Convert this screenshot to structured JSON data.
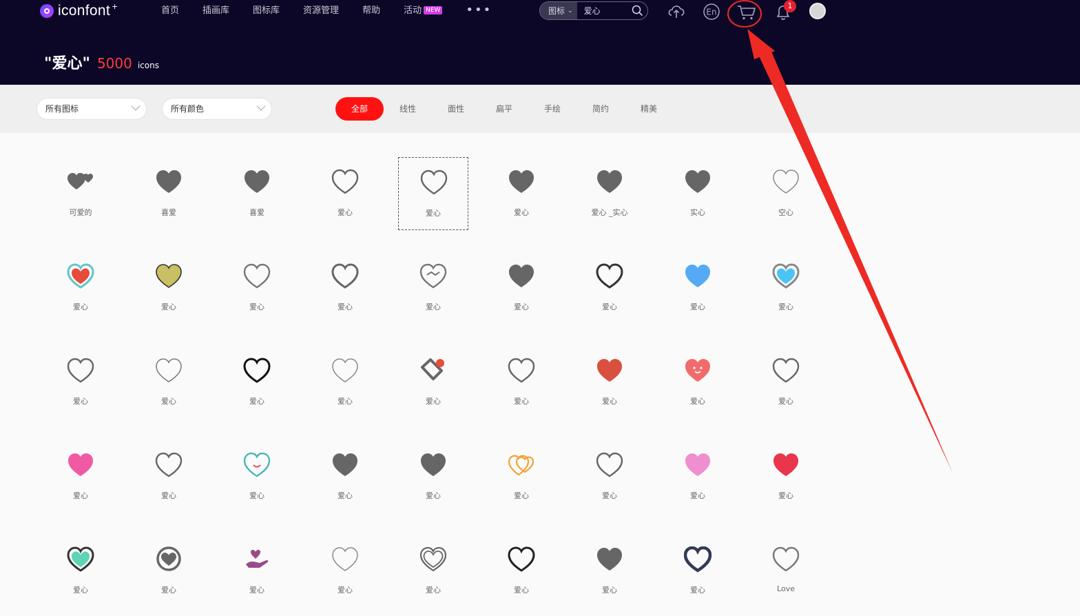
{
  "header": {
    "logo_text": "iconfont",
    "logo_plus": "+",
    "nav": [
      {
        "label": "首页"
      },
      {
        "label": "插画库"
      },
      {
        "label": "图标库"
      },
      {
        "label": "资源管理"
      },
      {
        "label": "帮助"
      },
      {
        "label": "活动",
        "badge": "NEW"
      }
    ],
    "more": "•••",
    "search": {
      "type": "图标",
      "value": "爱心"
    },
    "notification_count": "1",
    "icons": [
      "upload-icon",
      "language-en-icon",
      "cart-icon",
      "bell-icon"
    ]
  },
  "result": {
    "query": "\"爱心\"",
    "count": "5000",
    "unit": "icons"
  },
  "filters": {
    "category": "所有图标",
    "color": "所有颜色",
    "tabs": [
      "全部",
      "线性",
      "面性",
      "扁平",
      "手绘",
      "简约",
      "精美"
    ],
    "active_tab": "全部"
  },
  "icons": [
    {
      "label": "可爱的",
      "style": "double",
      "color": "#666666"
    },
    {
      "label": "喜爱",
      "style": "solid",
      "color": "#666666"
    },
    {
      "label": "喜爱",
      "style": "solid",
      "color": "#666666"
    },
    {
      "label": "爱心",
      "style": "outline",
      "color": "#666666"
    },
    {
      "label": "爱心",
      "style": "outline",
      "color": "#666666"
    },
    {
      "label": "爱心",
      "style": "solid",
      "color": "#666666"
    },
    {
      "label": "爱心 _实心",
      "style": "solid",
      "color": "#666666"
    },
    {
      "label": "实心",
      "style": "solid",
      "color": "#666666"
    },
    {
      "label": "空心",
      "style": "outline-thin",
      "color": "#888888"
    },
    {
      "label": "爱心",
      "style": "two-tone",
      "color": "#e84b3a",
      "accent": "#5fc6c9"
    },
    {
      "label": "爱心",
      "style": "solid-outline",
      "color": "#c9c063"
    },
    {
      "label": "爱心",
      "style": "outline",
      "color": "#777777"
    },
    {
      "label": "爱心",
      "style": "outline-bold",
      "color": "#666666"
    },
    {
      "label": "爱心",
      "style": "handshake",
      "color": "#777777"
    },
    {
      "label": "爱心",
      "style": "solid",
      "color": "#666666"
    },
    {
      "label": "爱心",
      "style": "outline-bold",
      "color": "#333333"
    },
    {
      "label": "爱心",
      "style": "solid",
      "color": "#55aaf5"
    },
    {
      "label": "爱心",
      "style": "two-tone",
      "color": "#4cc3f5",
      "accent": "#888888"
    },
    {
      "label": "爱心",
      "style": "outline",
      "color": "#666666"
    },
    {
      "label": "爱心",
      "style": "outline-thin",
      "color": "#777777"
    },
    {
      "label": "爱心",
      "style": "outline-bold",
      "color": "#111111"
    },
    {
      "label": "爱心",
      "style": "outline-thin",
      "color": "#888888"
    },
    {
      "label": "爱心",
      "style": "tag",
      "color": "#666666",
      "accent": "#e84b3a"
    },
    {
      "label": "爱心",
      "style": "outline",
      "color": "#666666"
    },
    {
      "label": "爱心",
      "style": "solid",
      "color": "#d9503f"
    },
    {
      "label": "爱心",
      "style": "cartoon",
      "color": "#f26b6b"
    },
    {
      "label": "爱心",
      "style": "outline",
      "color": "#666666"
    },
    {
      "label": "爱心",
      "style": "solid",
      "color": "#f05aa3"
    },
    {
      "label": "爱心",
      "style": "outline",
      "color": "#666666"
    },
    {
      "label": "爱心",
      "style": "smile",
      "color": "#3fb3b0",
      "accent": "#e84b6a"
    },
    {
      "label": "爱心",
      "style": "solid",
      "color": "#666666"
    },
    {
      "label": "爱心",
      "style": "solid",
      "color": "#666666"
    },
    {
      "label": "爱心",
      "style": "double-outline",
      "color": "#f2a233"
    },
    {
      "label": "爱心",
      "style": "outline",
      "color": "#666666"
    },
    {
      "label": "爱心",
      "style": "solid",
      "color": "#ef8fcf"
    },
    {
      "label": "爱心",
      "style": "solid",
      "color": "#e8364c"
    },
    {
      "label": "爱心",
      "style": "two-tone",
      "color": "#5fd4b4",
      "accent": "#333333"
    },
    {
      "label": "爱心",
      "style": "ring",
      "color": "#666666"
    },
    {
      "label": "爱心",
      "style": "hand",
      "color": "#9a4a8a"
    },
    {
      "label": "爱心",
      "style": "outline-thin",
      "color": "#888888"
    },
    {
      "label": "爱心",
      "style": "double-line",
      "color": "#666666"
    },
    {
      "label": "爱心",
      "style": "outline-bold",
      "color": "#222222"
    },
    {
      "label": "爱心",
      "style": "solid",
      "color": "#666666"
    },
    {
      "label": "爱心",
      "style": "outline-heavy",
      "color": "#333a55"
    },
    {
      "label": "Love",
      "style": "outline",
      "color": "#777777"
    }
  ]
}
